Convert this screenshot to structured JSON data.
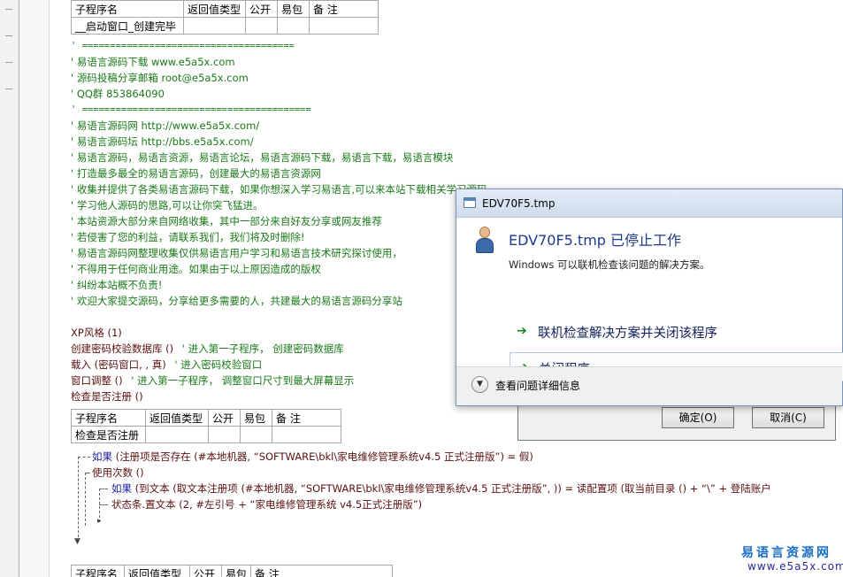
{
  "table_headers": [
    "子程序名",
    "返回值类型",
    "公开",
    "易包",
    "备 注"
  ],
  "sub1": {
    "name": "__启动窗口_创建完毕"
  },
  "comments": [
    "' ======================================",
    "' 易语言源码下载     www.e5a5x.com",
    "' 源码投稿分享邮箱  root@e5a5x.com",
    "' QQ群    853864090",
    "' =========================================",
    "' 易语言源码网 http://www.e5a5x.com/",
    "' 易语言源码坛 http://bbs.e5a5x.com/",
    "' 易语言源码，易语言资源，易语言论坛，易语言源码下载，易语言下载，易语言模块",
    "' 打造最多最全的易语言源码，创建最大的易语言资源网",
    "' 收集并提供了各类易语言源码下载，如果你想深入学习易语言,可以来本站下载相关学习源码",
    "' 学习他人源码的思路,可以让你突飞猛进。",
    "' 本站资源大部分来自网络收集，其中一部分来自好友分享或网友推荐",
    "' 若侵害了您的利益，请联系我们，我们将及时删除!",
    "' 易语言源码网整理收集仅供易语言用户学习和易语言技术研究探讨使用，",
    "' 不得用于任何商业用途。如果由于以上原因造成的版权",
    "' 纠纷本站概不负责!",
    "' 欢迎大家提交源码，分享给更多需要的人，共建最大的易语言源码分享站"
  ],
  "code": {
    "xp": "XP风格 (1)",
    "l1_code": "创建密码校验数据库 ()",
    "l1_cmt": "' 进入第一子程序， 创建密码数据库",
    "l2_code": "载入 (密码窗口, , 真)",
    "l2_cmt": "' 进入密码校验窗口",
    "l3_code": "窗口调整 ()",
    "l3_cmt": "' 进入第一子程序， 调整窗口尺寸到最大屏幕显示",
    "l4_code": "检查是否注册 ()"
  },
  "sub2": {
    "name": "检查是否注册"
  },
  "code2": {
    "if1_kw": "如果",
    "if1_rest": "(注册项是否存在 (#本地机器, “SOFTWARE\\bkl\\家电维修管理系统v4.5 正式注册版”) = 假)",
    "use_count": "使用次数 ()",
    "if2_kw": "如果",
    "if2_rest": "(到文本 (取文本注册项 (#本地机器, “SOFTWARE\\bkl\\家电维修管理系统v4.5 正式注册版”, )) = 读配置项 (取当前目录 () + “\\” + 登陆账户",
    "status_line": "状态条.置文本 (2, #左引号 + “家电维修管理系统 v4.5正式注册版”)"
  },
  "behind_dialog": {
    "ok": "确定(O)",
    "cancel": "取消(C)"
  },
  "dialog": {
    "title": "EDV70F5.tmp",
    "heading": "EDV70F5.tmp 已停止工作",
    "subtext": "Windows 可以联机检查该问题的解决方案。",
    "option1": "联机检查解决方案并关闭该程序",
    "option2": "关闭程序",
    "details": "查看问题详细信息"
  },
  "watermark": {
    "line1": "易语言资源网",
    "line2": "www.e5a5x.com"
  }
}
